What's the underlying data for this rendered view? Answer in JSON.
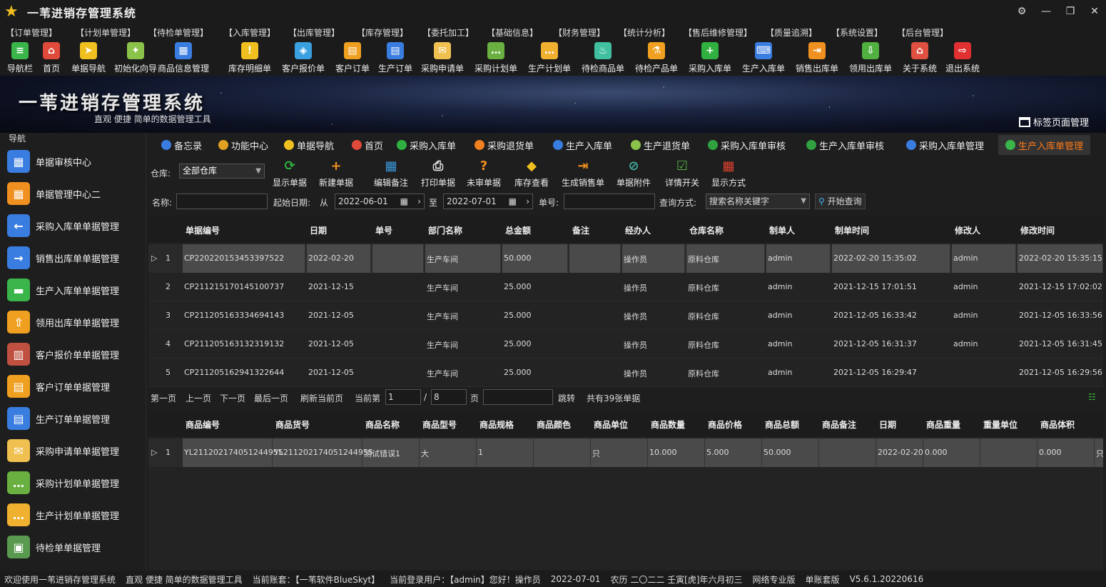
{
  "app": {
    "title": "一苇进销存管理系统"
  },
  "menu": [
    "【订单管理】",
    "【计划单管理】",
    "【待检单管理】",
    "【入库管理】",
    "【出库管理】",
    "【库存管理】",
    "【委托加工】",
    "【基础信息】",
    "【财务管理】",
    "【统计分析】",
    "【售后维修管理】",
    "【质量追溯】",
    "【系统设置】",
    "【后台管理】"
  ],
  "toolbar": [
    {
      "label": "导航栏",
      "icon": "menu-icon",
      "color": "#3ab54a",
      "glyph": "≡"
    },
    {
      "label": "首页",
      "icon": "home-icon",
      "color": "#e04a3a",
      "glyph": "⌂"
    },
    {
      "label": "单据导航",
      "icon": "compass-icon",
      "color": "#f0c020",
      "glyph": "➤"
    },
    {
      "label": "初始化向导",
      "icon": "wand-icon",
      "color": "#8bc34a",
      "glyph": "✦"
    },
    {
      "label": "商品信息管理",
      "icon": "cubes-icon",
      "color": "#3a7de0",
      "glyph": "▦"
    },
    {
      "label": "库存明细单",
      "icon": "warning-icon",
      "color": "#f0c020",
      "glyph": "!"
    },
    {
      "label": "客户报价单",
      "icon": "tag-icon",
      "color": "#3aa0e0",
      "glyph": "◈"
    },
    {
      "label": "客户订单",
      "icon": "doc-icon",
      "color": "#f0a020",
      "glyph": "▤"
    },
    {
      "label": "生产订单",
      "icon": "doc-icon",
      "color": "#3a7de0",
      "glyph": "▤"
    },
    {
      "label": "采购申请单",
      "icon": "envelope-icon",
      "color": "#f0c050",
      "glyph": "✉"
    },
    {
      "label": "采购计划单",
      "icon": "chat-icon",
      "color": "#6ab040",
      "glyph": "…"
    },
    {
      "label": "生产计划单",
      "icon": "chat-icon",
      "color": "#f0b030",
      "glyph": "…"
    },
    {
      "label": "待检商品单",
      "icon": "flask-icon",
      "color": "#40c0a0",
      "glyph": "♨"
    },
    {
      "label": "待检产品单",
      "icon": "flask-icon",
      "color": "#f0a020",
      "glyph": "⚗"
    },
    {
      "label": "采购入库单",
      "icon": "plus-icon",
      "color": "#30b040",
      "glyph": "+"
    },
    {
      "label": "生产入库单",
      "icon": "mobile-icon",
      "color": "#3a7de0",
      "glyph": "⌨"
    },
    {
      "label": "销售出库单",
      "icon": "export-icon",
      "color": "#f09020",
      "glyph": "⇥"
    },
    {
      "label": "领用出库单",
      "icon": "download-icon",
      "color": "#50b040",
      "glyph": "⇩"
    },
    {
      "label": "关于系统",
      "icon": "home-icon",
      "color": "#e05040",
      "glyph": "⌂"
    },
    {
      "label": "退出系统",
      "icon": "exit-icon",
      "color": "#e03030",
      "glyph": "⇨"
    }
  ],
  "banner": {
    "title": "一苇进销存管理系统",
    "subtitle": "直观 便捷 简单的数据管理工具",
    "tab_manager": "标签页面管理"
  },
  "leftnav": {
    "header": "导航",
    "items": [
      {
        "label": "单据审核中心",
        "icon": "grid-icon",
        "color": "#3a7de0",
        "glyph": "▦"
      },
      {
        "label": "单据管理中心二",
        "icon": "grid-icon",
        "color": "#f09020",
        "glyph": "▦"
      },
      {
        "label": "采购入库单单据管理",
        "icon": "import-icon",
        "color": "#3a7de0",
        "glyph": "←"
      },
      {
        "label": "销售出库单单据管理",
        "icon": "export-icon",
        "color": "#3a7de0",
        "glyph": "→"
      },
      {
        "label": "生产入库单单据管理",
        "icon": "folder-icon",
        "color": "#3ab54a",
        "glyph": "▬"
      },
      {
        "label": "领用出库单单据管理",
        "icon": "upload-icon",
        "color": "#f0a020",
        "glyph": "⇧"
      },
      {
        "label": "客户报价单单据管理",
        "icon": "books-icon",
        "color": "#c05040",
        "glyph": "▥"
      },
      {
        "label": "客户订单单据管理",
        "icon": "doc-icon",
        "color": "#f0a020",
        "glyph": "▤"
      },
      {
        "label": "生产订单单据管理",
        "icon": "doc-icon",
        "color": "#3a7de0",
        "glyph": "▤"
      },
      {
        "label": "采购申请单单据管理",
        "icon": "envelope-icon",
        "color": "#f0c050",
        "glyph": "✉"
      },
      {
        "label": "采购计划单单据管理",
        "icon": "chat-icon",
        "color": "#6ab040",
        "glyph": "…"
      },
      {
        "label": "生产计划单单据管理",
        "icon": "chat-icon",
        "color": "#f0b030",
        "glyph": "…"
      },
      {
        "label": "待检单单据管理",
        "icon": "clipboard-icon",
        "color": "#5a9a50",
        "glyph": "▣"
      }
    ]
  },
  "tabs": [
    {
      "label": "备忘录",
      "icon": "memo-icon",
      "color": "#3a7de0"
    },
    {
      "label": "功能中心",
      "icon": "apps-icon",
      "color": "#e0a020"
    },
    {
      "label": "单据导航",
      "icon": "compass-icon",
      "color": "#f0c020"
    },
    {
      "label": "首页",
      "icon": "home-icon",
      "color": "#e04a3a"
    },
    {
      "label": "采购入库单",
      "icon": "plus-icon",
      "color": "#30b040"
    },
    {
      "label": "采购退货单",
      "icon": "minus-icon",
      "color": "#f08020"
    },
    {
      "label": "生产入库单",
      "icon": "mobile-icon",
      "color": "#3a7de0"
    },
    {
      "label": "生产退货单",
      "icon": "diamond-icon",
      "color": "#8bc34a"
    },
    {
      "label": "采购入库单审核",
      "icon": "check-icon",
      "color": "#30a040"
    },
    {
      "label": "生产入库单审核",
      "icon": "check-icon",
      "color": "#30a040"
    },
    {
      "label": "采购入库单管理",
      "icon": "import-icon",
      "color": "#3a7de0"
    },
    {
      "label": "生产入库单管理",
      "icon": "folder-icon",
      "color": "#3ab54a"
    }
  ],
  "active_tab": "生产入库单管理",
  "actions": {
    "warehouse_label": "仓库:",
    "warehouse_value": "全部仓库",
    "buttons": [
      {
        "label": "显示单据",
        "icon": "refresh-icon",
        "color": "#30b040",
        "glyph": "⟳"
      },
      {
        "label": "新建单据",
        "icon": "add-icon",
        "color": "#f09020",
        "glyph": "+"
      },
      {
        "label": "编辑备注",
        "icon": "calendar-edit-icon",
        "color": "#3a9ae0",
        "glyph": "▦"
      },
      {
        "label": "打印单据",
        "icon": "printer-icon",
        "color": "#dddddd",
        "glyph": "⎙"
      },
      {
        "label": "未审单据",
        "icon": "question-icon",
        "color": "#f09020",
        "glyph": "?"
      },
      {
        "label": "库存查看",
        "icon": "box-icon",
        "color": "#f0c020",
        "glyph": "◆"
      },
      {
        "label": "生成销售单",
        "icon": "export-icon",
        "color": "#f09020",
        "glyph": "⇥"
      },
      {
        "label": "单据附件",
        "icon": "paperclip-icon",
        "color": "#40b0a0",
        "glyph": "⊘"
      },
      {
        "label": "详情开关",
        "icon": "checklist-icon",
        "color": "#50b040",
        "glyph": "☑"
      },
      {
        "label": "显示方式",
        "icon": "tiles-icon",
        "color": "#e04030",
        "glyph": "▦"
      }
    ]
  },
  "filters": {
    "name_label": "名称:",
    "name_value": "",
    "start_label": "起始日期:",
    "from_label": "从",
    "from_date": "2022-06-01",
    "to_label": "至",
    "to_date": "2022-07-01",
    "doc_no_label": "单号:",
    "doc_no_value": "",
    "query_label": "查询方式:",
    "query_value": "搜索名称关键字",
    "search_button": "开始查询"
  },
  "main_table": {
    "columns": [
      "单据编号",
      "日期",
      "单号",
      "部门名称",
      "总金额",
      "备注",
      "经办人",
      "仓库名称",
      "制单人",
      "制单时间",
      "修改人",
      "修改时间"
    ],
    "rows": [
      {
        "idx": "1",
        "no": "CP220220153453397522",
        "date": "2022-02-20",
        "doc": "",
        "dept": "生产车间",
        "amount": "50.000",
        "note": "",
        "handler": "操作员",
        "wh": "原料仓库",
        "maker": "admin",
        "mtime": "2022-02-20 15:35:02",
        "editor": "admin",
        "etime": "2022-02-20 15:35:15"
      },
      {
        "idx": "2",
        "no": "CP211215170145100737",
        "date": "2021-12-15",
        "doc": "",
        "dept": "生产车间",
        "amount": "25.000",
        "note": "",
        "handler": "操作员",
        "wh": "原料仓库",
        "maker": "admin",
        "mtime": "2021-12-15 17:01:51",
        "editor": "admin",
        "etime": "2021-12-15 17:02:02"
      },
      {
        "idx": "3",
        "no": "CP211205163334694143",
        "date": "2021-12-05",
        "doc": "",
        "dept": "生产车间",
        "amount": "25.000",
        "note": "",
        "handler": "操作员",
        "wh": "原料仓库",
        "maker": "admin",
        "mtime": "2021-12-05 16:33:42",
        "editor": "admin",
        "etime": "2021-12-05 16:33:56"
      },
      {
        "idx": "4",
        "no": "CP211205163132319132",
        "date": "2021-12-05",
        "doc": "",
        "dept": "生产车间",
        "amount": "25.000",
        "note": "",
        "handler": "操作员",
        "wh": "原料仓库",
        "maker": "admin",
        "mtime": "2021-12-05 16:31:37",
        "editor": "admin",
        "etime": "2021-12-05 16:31:45"
      },
      {
        "idx": "5",
        "no": "CP211205162941322644",
        "date": "2021-12-05",
        "doc": "",
        "dept": "生产车间",
        "amount": "25.000",
        "note": "",
        "handler": "操作员",
        "wh": "原料仓库",
        "maker": "admin",
        "mtime": "2021-12-05 16:29:47",
        "editor": "",
        "etime": "2021-12-05 16:29:56"
      }
    ]
  },
  "pager": {
    "first": "第一页",
    "prev": "上一页",
    "next": "下一页",
    "last": "最后一页",
    "refresh": "刷新当前页",
    "current_label": "当前第",
    "current": "1",
    "sep": "/",
    "total_pages": "8",
    "page_label": "页",
    "jump_value": "",
    "jump": "跳转",
    "total": "共有39张单据"
  },
  "detail_table": {
    "columns": [
      "商品编号",
      "商品货号",
      "商品名称",
      "商品型号",
      "商品规格",
      "商品颜色",
      "商品单位",
      "商品数量",
      "商品价格",
      "商品总额",
      "商品备注",
      "日期",
      "商品重量",
      "重量单位",
      "商品体积"
    ],
    "rows": [
      {
        "idx": "1",
        "code": "YL211202174051244955",
        "art": "YL211202174051244955",
        "name": "测试错误1",
        "model": "大",
        "spec": "1",
        "color": "",
        "unit": "只",
        "qty": "10.000",
        "price": "5.000",
        "total": "50.000",
        "note": "",
        "date": "2022-02-20",
        "weight": "0.000",
        "wunit": "",
        "vol": "0.000",
        "extra": "只"
      }
    ]
  },
  "status": [
    "欢迎使用一苇进销存管理系统",
    "直观 便捷 简单的数据管理工具",
    "当前账套：【一苇软件BlueSkyt】",
    "当前登录用户：【admin】您好！操作员",
    "2022-07-01",
    "农历 二〇二二 壬寅[虎]年六月初三",
    "网络专业版",
    "单账套版",
    "V5.6.1.20220616"
  ]
}
